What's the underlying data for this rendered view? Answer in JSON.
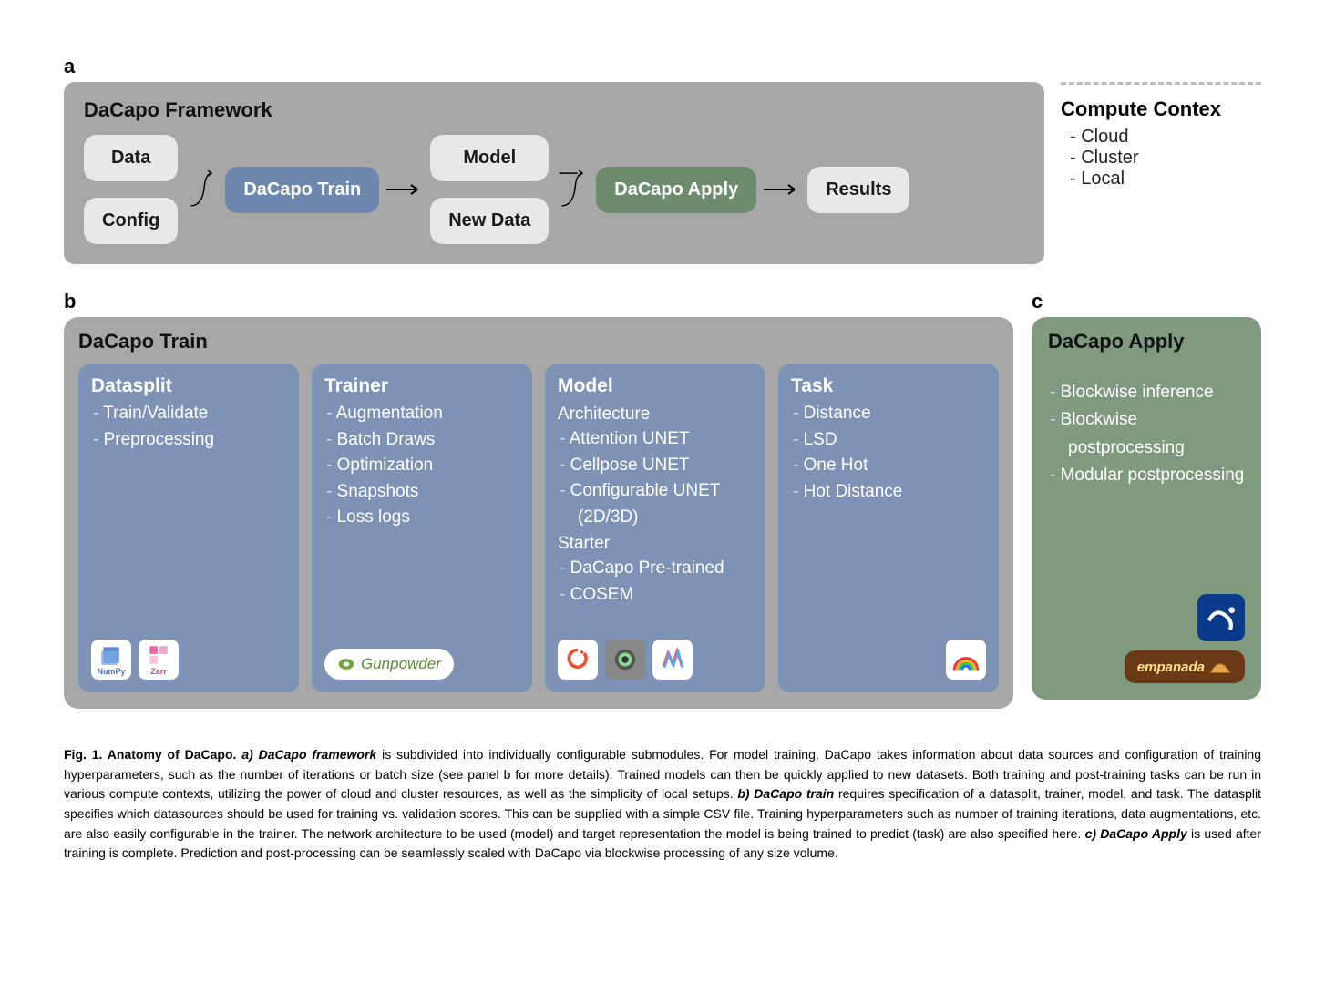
{
  "panel_a": {
    "label": "a",
    "title": "DaCapo Framework",
    "chips": {
      "data": "Data",
      "config": "Config",
      "train": "DaCapo Train",
      "model": "Model",
      "newdata": "New Data",
      "apply": "DaCapo Apply",
      "results": "Results"
    },
    "compute_title": "Compute Contex",
    "compute_items": [
      "Cloud",
      "Cluster",
      "Local"
    ]
  },
  "panel_b": {
    "label": "b",
    "title": "DaCapo Train",
    "cards": [
      {
        "title": "Datasplit",
        "items": [
          "Train/Validate",
          "Preprocessing"
        ],
        "footer_logos": [
          "NumPy",
          "Zarr"
        ]
      },
      {
        "title": "Trainer",
        "items": [
          "Augmentation",
          "Batch Draws",
          "Optimization",
          "Snapshots",
          "Loss logs"
        ],
        "footer_logos": [
          "Gunpowder"
        ]
      },
      {
        "title": "Model",
        "sections": [
          {
            "label": "Architecture",
            "items": [
              "Attention UNET",
              "Cellpose UNET",
              "Configurable UNET (2D/3D)"
            ]
          },
          {
            "label": "Starter",
            "items": [
              "DaCapo Pre-trained",
              "COSEM"
            ]
          }
        ],
        "footer_logos": [
          "PyTorch",
          "Cellpose",
          "Neuroglancer"
        ]
      },
      {
        "title": "Task",
        "items": [
          "Distance",
          "LSD",
          "One Hot",
          "Hot Distance"
        ],
        "footer_logos": [
          "Rainbow"
        ]
      }
    ]
  },
  "panel_c": {
    "label": "c",
    "title": "DaCapo Apply",
    "items": [
      "Blockwise inference",
      "Blockwise postprocessing",
      "Modular postprocessing"
    ],
    "footer_logos": [
      "SciPy",
      "empanada"
    ]
  },
  "caption": {
    "figlabel": "Fig. 1.  Anatomy of DaCapo.",
    "a_label": "a) DaCapo framework",
    "a_text": " is subdivided into individually configurable submodules. For model training, DaCapo takes information about data sources and configuration of training hyperparameters, such as the number of iterations or batch size (see panel b for more details). Trained models can then be quickly applied to new datasets. Both training and post-training tasks can be run in various compute contexts, utilizing the power of cloud and cluster resources, as well as the simplicity of local setups. ",
    "b_label": "b) DaCapo train",
    "b_text": " requires specification of a datasplit, trainer, model, and task. The datasplit specifies which datasources should be used for training vs. validation scores. This can be supplied with a simple CSV file. Training hyperparameters such as number of training iterations, data augmentations, etc. are also easily configurable in the trainer. The network architecture to be used (model) and target representation the model is being trained to predict (task) are also specified here. ",
    "c_label": "c) DaCapo Apply",
    "c_text": " is used after training is complete. Prediction and post-processing can be seamlessly scaled with DaCapo via blockwise processing of any size volume."
  }
}
